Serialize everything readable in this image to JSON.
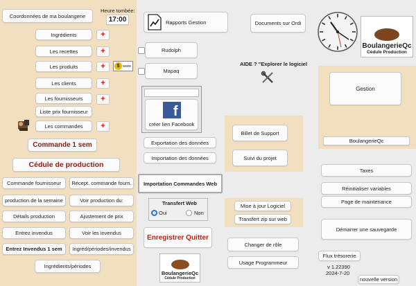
{
  "left": {
    "coord_button": "Coordonnées de ma boulangerie",
    "time_label": "Heure tombée:",
    "time_value": "17:00",
    "items": [
      "Ingrédients",
      "Les recettes",
      "Les produits",
      "Les clients",
      "Les fournisseurs",
      "Liste prix fournisseur",
      "Les commandes"
    ],
    "plus": "+",
    "www_badge": "www",
    "commande_sem": "Commande 1 sem",
    "cedule": "Cédule de production",
    "grid": [
      "Commande fournisseur",
      "Récept. commande fourn.",
      "production de la semaine",
      "Voir production du:",
      "Détails production",
      "Ajustement de prix",
      "Entrez  invendus",
      "Voir les invendus",
      "Entrez Invendus 1 sem",
      "Ingréd/périodes/invendus"
    ],
    "ingr_periodes": "Ingrédients/périodes"
  },
  "middle": {
    "rapports": "Rapports Gestion",
    "rudolph": "Rudolph",
    "mapaq": "Mapaq",
    "facebook_link": "créer lien Facebook",
    "export": "Exportation des données",
    "import": "Importation des données",
    "import_cmd": "Importation Commandes Web",
    "transfert_title": "Transfert Web",
    "radio_oui": "Oui",
    "radio_non": "Non",
    "save_quit": "Enregistrer Quitter",
    "logo_name": "BoulangerieQc",
    "logo_sub": "Cédule Production"
  },
  "center": {
    "documents": "Documents sur Ordi",
    "aide": "AIDE ? \"Explorer le logiciel",
    "billet": "Billet de Support",
    "suivi": "Suivi du projet",
    "maj": "Mise à jour Logiciel",
    "transfert_zip": "Transfert zip sur web",
    "changer_role": "Changer de rôle",
    "usage_prog": "Usage Programmeur"
  },
  "right": {
    "logo_name": "BoulangerieQc",
    "logo_sub": "Cédule Production",
    "gestion": "Gestion",
    "company": "BoulangerieQc",
    "taxes": "Taxes",
    "reinit": "Réinitialiser variables",
    "maintenance": "Page de maintenance",
    "demarrer": "Démarrer une sauvegarde",
    "flux": "Flux trésorerie",
    "version": "v 1.22390",
    "date": "2024-7-20",
    "nouvelle": "nouvelle version"
  },
  "colors": {
    "panel": "#f1dfc0",
    "accent_red": "#8b1a12",
    "plus_red": "#dd1111",
    "facebook_blue": "#3b5998"
  }
}
